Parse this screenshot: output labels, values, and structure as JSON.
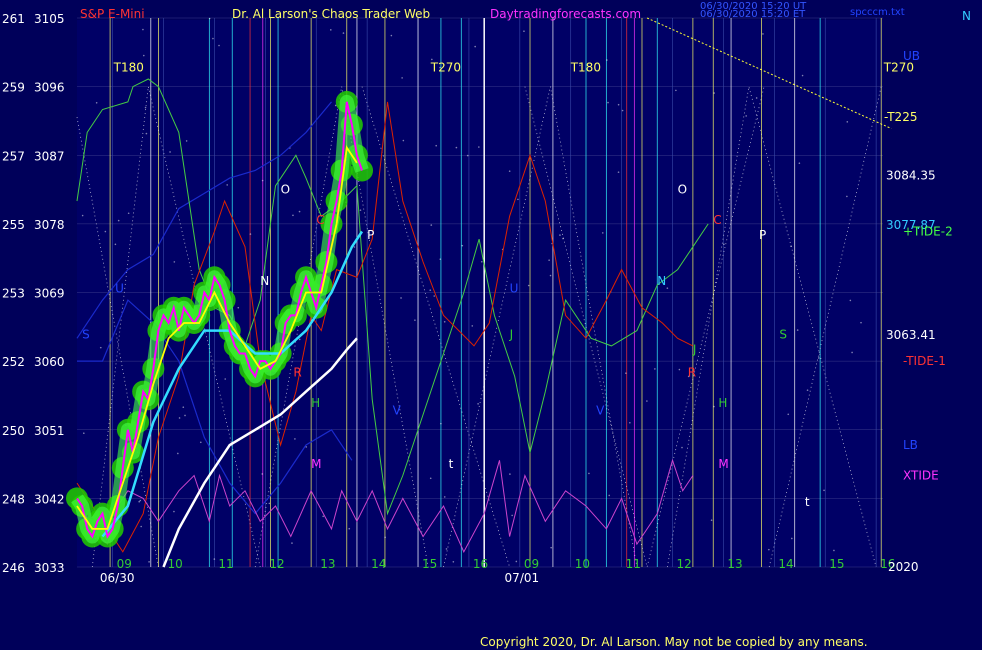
{
  "header": {
    "symbol": "S&P E-Mini",
    "title": "Dr. Al Larson's Chaos Trader Web",
    "site": "Daytradingforecasts.com",
    "timestamp1": "06/30/2020 15:20 UT",
    "timestamp2": "06/30/2020 15:20 ET",
    "file": "spcccm.txt",
    "corner": "N"
  },
  "footer": {
    "copyright": "Copyright 2020, Dr. Al Larson. May not be copied by any means."
  },
  "colors": {
    "background": "#00005a",
    "price_bars": "#ff00ff",
    "price_glow": "#22cc00",
    "fast_ma": "#ffff00",
    "mid_ma": "#33ddff",
    "slow_ma": "#ffffff",
    "tide_plus": "#44cc44",
    "tide_minus": "#dd2200",
    "xtide": "#cc44cc",
    "bands": "#1a2acc"
  },
  "chart_data": {
    "type": "line",
    "y_left_axis": {
      "labels": [
        "261",
        "259",
        "257",
        "255",
        "253",
        "252",
        "250",
        "248",
        "246"
      ],
      "values": [
        3105,
        3096,
        3087,
        3078,
        3069,
        3060,
        3051,
        3042,
        3033
      ]
    },
    "ylim": [
      3033,
      3105
    ],
    "x_hour_ticks": [
      "09",
      "10",
      "11",
      "12",
      "13",
      "14",
      "15",
      "16",
      "09",
      "10",
      "11",
      "12",
      "13",
      "14",
      "15",
      "16"
    ],
    "x_dates": [
      "06/30",
      "07/01"
    ],
    "right_levels": [
      {
        "label": "3084.35",
        "value": 3084.35
      },
      {
        "label": "3077.87",
        "value": 3077.87
      },
      {
        "label": "3063.41",
        "value": 3063.41
      }
    ],
    "legend": [
      "UB",
      "-T225",
      "+TIDE-2",
      "-TIDE-1",
      "LB",
      "XTIDE",
      "2020"
    ],
    "cycle_labels": [
      "T180",
      "T270",
      "T180",
      "T270"
    ],
    "planet_labels": [
      "O",
      "C",
      "P",
      "N",
      "U",
      "S",
      "R",
      "H",
      "M",
      "V",
      "J",
      "t",
      "O",
      "C",
      "P",
      "N",
      "U",
      "S",
      "R",
      "H",
      "M",
      "V",
      "J",
      "t"
    ],
    "price_series": [
      [
        0,
        3042
      ],
      [
        0.1,
        3041
      ],
      [
        0.2,
        3038
      ],
      [
        0.3,
        3037
      ],
      [
        0.4,
        3039
      ],
      [
        0.5,
        3040
      ],
      [
        0.6,
        3037
      ],
      [
        0.7,
        3038
      ],
      [
        0.8,
        3041
      ],
      [
        0.9,
        3046
      ],
      [
        1.0,
        3051
      ],
      [
        1.1,
        3048
      ],
      [
        1.2,
        3052
      ],
      [
        1.3,
        3056
      ],
      [
        1.4,
        3055
      ],
      [
        1.5,
        3059
      ],
      [
        1.6,
        3064
      ],
      [
        1.7,
        3066
      ],
      [
        1.8,
        3065
      ],
      [
        1.9,
        3067
      ],
      [
        2.0,
        3064
      ],
      [
        2.1,
        3067
      ],
      [
        2.2,
        3066
      ],
      [
        2.3,
        3065
      ],
      [
        2.4,
        3066
      ],
      [
        2.5,
        3069
      ],
      [
        2.6,
        3068
      ],
      [
        2.7,
        3071
      ],
      [
        2.8,
        3070
      ],
      [
        2.9,
        3068
      ],
      [
        3.0,
        3064
      ],
      [
        3.1,
        3062
      ],
      [
        3.2,
        3061
      ],
      [
        3.3,
        3061
      ],
      [
        3.4,
        3059
      ],
      [
        3.5,
        3058
      ],
      [
        3.6,
        3060
      ],
      [
        3.7,
        3060
      ],
      [
        3.8,
        3059
      ],
      [
        3.9,
        3060
      ],
      [
        4.0,
        3061
      ],
      [
        4.1,
        3065
      ],
      [
        4.2,
        3066
      ],
      [
        4.3,
        3066
      ],
      [
        4.4,
        3069
      ],
      [
        4.5,
        3071
      ],
      [
        4.6,
        3069
      ],
      [
        4.7,
        3067
      ],
      [
        4.8,
        3070
      ],
      [
        4.9,
        3073
      ],
      [
        5.0,
        3078
      ],
      [
        5.1,
        3081
      ],
      [
        5.2,
        3085
      ],
      [
        5.3,
        3094
      ],
      [
        5.4,
        3091
      ],
      [
        5.5,
        3087
      ],
      [
        5.6,
        3085
      ]
    ],
    "fast_ma": [
      [
        0,
        3041
      ],
      [
        0.3,
        3038
      ],
      [
        0.6,
        3038
      ],
      [
        0.9,
        3044
      ],
      [
        1.2,
        3050
      ],
      [
        1.5,
        3057
      ],
      [
        1.8,
        3063
      ],
      [
        2.1,
        3065
      ],
      [
        2.4,
        3065
      ],
      [
        2.7,
        3069
      ],
      [
        3.0,
        3065
      ],
      [
        3.3,
        3062
      ],
      [
        3.6,
        3059
      ],
      [
        3.9,
        3060
      ],
      [
        4.2,
        3064
      ],
      [
        4.5,
        3069
      ],
      [
        4.8,
        3069
      ],
      [
        5.1,
        3078
      ],
      [
        5.3,
        3088
      ],
      [
        5.5,
        3086
      ]
    ],
    "mid_ma": [
      [
        0.5,
        3037
      ],
      [
        1.0,
        3041
      ],
      [
        1.5,
        3052
      ],
      [
        2.0,
        3059
      ],
      [
        2.5,
        3064
      ],
      [
        3.0,
        3064
      ],
      [
        3.5,
        3061
      ],
      [
        4.0,
        3061
      ],
      [
        4.5,
        3064
      ],
      [
        5.0,
        3069
      ],
      [
        5.4,
        3075
      ],
      [
        5.6,
        3077
      ]
    ],
    "slow_ma": [
      [
        1.7,
        3033
      ],
      [
        2.0,
        3038
      ],
      [
        2.5,
        3044
      ],
      [
        3.0,
        3049
      ],
      [
        3.5,
        3051
      ],
      [
        4.0,
        3053
      ],
      [
        4.5,
        3056
      ],
      [
        5.0,
        3059
      ],
      [
        5.3,
        3061.5
      ],
      [
        5.5,
        3063
      ]
    ],
    "tide_plus": [
      [
        0,
        3081
      ],
      [
        0.2,
        3090
      ],
      [
        0.5,
        3093
      ],
      [
        1.0,
        3094
      ],
      [
        1.1,
        3096
      ],
      [
        1.4,
        3097
      ],
      [
        1.6,
        3096
      ],
      [
        1.8,
        3093
      ],
      [
        2.0,
        3090
      ],
      [
        2.2,
        3081
      ],
      [
        2.4,
        3072
      ],
      [
        2.7,
        3067
      ],
      [
        3.0,
        3066
      ],
      [
        3.3,
        3062
      ],
      [
        3.6,
        3068
      ],
      [
        3.9,
        3083
      ],
      [
        4.3,
        3087
      ],
      [
        4.5,
        3084
      ],
      [
        4.8,
        3079
      ],
      [
        5.2,
        3081
      ],
      [
        5.5,
        3083
      ],
      [
        5.8,
        3055
      ],
      [
        6.1,
        3040
      ],
      [
        6.4,
        3045
      ],
      [
        6.8,
        3053
      ],
      [
        7.2,
        3061
      ],
      [
        7.6,
        3069
      ],
      [
        7.9,
        3076
      ],
      [
        8.2,
        3066
      ],
      [
        8.6,
        3058
      ],
      [
        8.9,
        3048
      ],
      [
        9.2,
        3056
      ],
      [
        9.6,
        3068
      ],
      [
        10.1,
        3063
      ],
      [
        10.5,
        3062
      ],
      [
        11.0,
        3064
      ],
      [
        11.4,
        3070
      ],
      [
        11.8,
        3072
      ],
      [
        12.1,
        3075
      ],
      [
        12.4,
        3078
      ]
    ],
    "tide_minus": [
      [
        0,
        3044
      ],
      [
        0.4,
        3040
      ],
      [
        0.9,
        3035
      ],
      [
        1.3,
        3040
      ],
      [
        1.6,
        3050
      ],
      [
        2.0,
        3058
      ],
      [
        2.3,
        3070
      ],
      [
        2.7,
        3077
      ],
      [
        2.9,
        3081
      ],
      [
        3.3,
        3075
      ],
      [
        3.6,
        3060
      ],
      [
        4.0,
        3049
      ],
      [
        4.3,
        3056
      ],
      [
        4.6,
        3066
      ],
      [
        4.8,
        3064
      ],
      [
        5.1,
        3072
      ],
      [
        5.5,
        3071
      ],
      [
        5.8,
        3076
      ],
      [
        6.1,
        3094
      ],
      [
        6.4,
        3081
      ],
      [
        6.8,
        3073
      ],
      [
        7.2,
        3066
      ],
      [
        7.5,
        3064
      ],
      [
        7.8,
        3062
      ],
      [
        8.1,
        3065
      ],
      [
        8.5,
        3079
      ],
      [
        8.9,
        3087
      ],
      [
        9.2,
        3081
      ],
      [
        9.6,
        3066
      ],
      [
        10.0,
        3063
      ],
      [
        10.4,
        3068
      ],
      [
        10.7,
        3072
      ],
      [
        11.1,
        3067
      ],
      [
        11.5,
        3065
      ],
      [
        11.8,
        3063
      ],
      [
        12.1,
        3062
      ]
    ],
    "xtide": [
      [
        0,
        3042
      ],
      [
        0.3,
        3038
      ],
      [
        0.6,
        3036
      ],
      [
        0.8,
        3041
      ],
      [
        1.0,
        3043
      ],
      [
        1.3,
        3042
      ],
      [
        1.6,
        3039
      ],
      [
        2.0,
        3043
      ],
      [
        2.3,
        3045
      ],
      [
        2.6,
        3039
      ],
      [
        2.8,
        3045
      ],
      [
        3.0,
        3041
      ],
      [
        3.3,
        3043
      ],
      [
        3.6,
        3039
      ],
      [
        3.9,
        3041
      ],
      [
        4.2,
        3037
      ],
      [
        4.6,
        3043
      ],
      [
        5.0,
        3038
      ],
      [
        5.2,
        3043
      ],
      [
        5.5,
        3039
      ],
      [
        5.8,
        3043
      ],
      [
        6.1,
        3038
      ],
      [
        6.4,
        3042
      ],
      [
        6.8,
        3037
      ],
      [
        7.2,
        3041
      ],
      [
        7.6,
        3035
      ],
      [
        8.0,
        3040
      ],
      [
        8.3,
        3047
      ],
      [
        8.5,
        3037
      ],
      [
        8.8,
        3045
      ],
      [
        9.2,
        3039
      ],
      [
        9.6,
        3043
      ],
      [
        10.0,
        3041
      ],
      [
        10.4,
        3038
      ],
      [
        10.7,
        3042
      ],
      [
        11.0,
        3036
      ],
      [
        11.4,
        3040
      ],
      [
        11.7,
        3047
      ],
      [
        11.9,
        3043
      ],
      [
        12.1,
        3045
      ]
    ],
    "upper_band": [
      [
        0,
        3063
      ],
      [
        0.5,
        3068
      ],
      [
        1.0,
        3072
      ],
      [
        1.5,
        3074
      ],
      [
        2.0,
        3080
      ],
      [
        2.5,
        3082
      ],
      [
        3.0,
        3084
      ],
      [
        3.5,
        3085
      ],
      [
        4.0,
        3087
      ],
      [
        4.5,
        3090
      ],
      [
        5.0,
        3094
      ]
    ],
    "lower_band": [
      [
        0,
        3060
      ],
      [
        0.5,
        3060
      ],
      [
        1.0,
        3068
      ],
      [
        1.5,
        3065
      ],
      [
        2.0,
        3060
      ],
      [
        2.5,
        3050
      ],
      [
        3.0,
        3044
      ],
      [
        3.5,
        3040
      ],
      [
        4.0,
        3044
      ],
      [
        4.5,
        3049
      ],
      [
        5.0,
        3051
      ],
      [
        5.4,
        3047
      ]
    ],
    "t225_line": [
      [
        11.2,
        3105
      ],
      [
        16.0,
        3090.5
      ]
    ]
  }
}
